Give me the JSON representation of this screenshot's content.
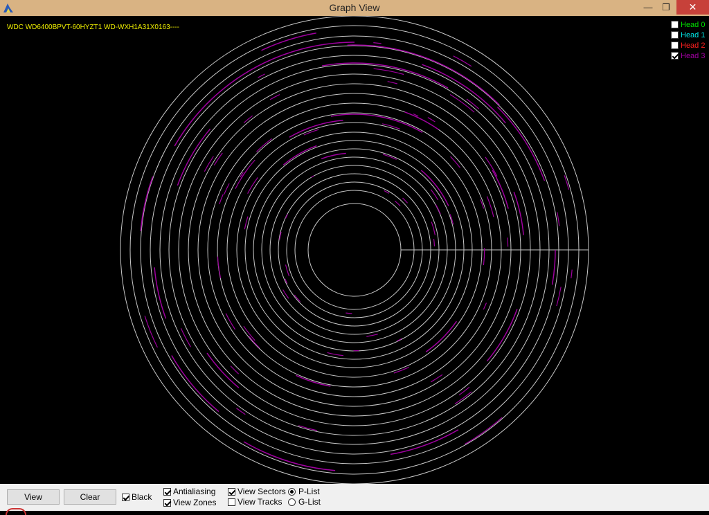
{
  "window": {
    "title": "Graph View",
    "minimize_glyph": "—",
    "restore_glyph": "❐",
    "close_glyph": "✕"
  },
  "drive": {
    "model": "WDC WD6400BPVT-60HYZT1 WD-WXH1A31X0163----"
  },
  "heads": [
    {
      "label": "Head 0",
      "checked": false,
      "color": "#00e000"
    },
    {
      "label": "Head 1",
      "checked": false,
      "color": "#00e8e8"
    },
    {
      "label": "Head 2",
      "checked": false,
      "color": "#ff2020"
    },
    {
      "label": "Head 3",
      "checked": true,
      "color": "#a000a0"
    }
  ],
  "toolbar": {
    "view_label": "View",
    "clear_label": "Clear",
    "black_label": "Black",
    "black_checked": true,
    "antialiasing_label": "Antialiasing",
    "antialiasing_checked": true,
    "view_zones_label": "View Zones",
    "view_zones_checked": true,
    "view_sectors_label": "View Sectors",
    "view_sectors_checked": true,
    "view_tracks_label": "View Tracks",
    "view_tracks_checked": false,
    "plist_label": "P-List",
    "plist_selected": true,
    "glist_label": "G-List",
    "glist_selected": false
  },
  "colors": {
    "titlebar": "#d9b383",
    "zone_ring": "#c8c8c8",
    "defect": "#a000a0",
    "model_text": "#f0f000"
  }
}
